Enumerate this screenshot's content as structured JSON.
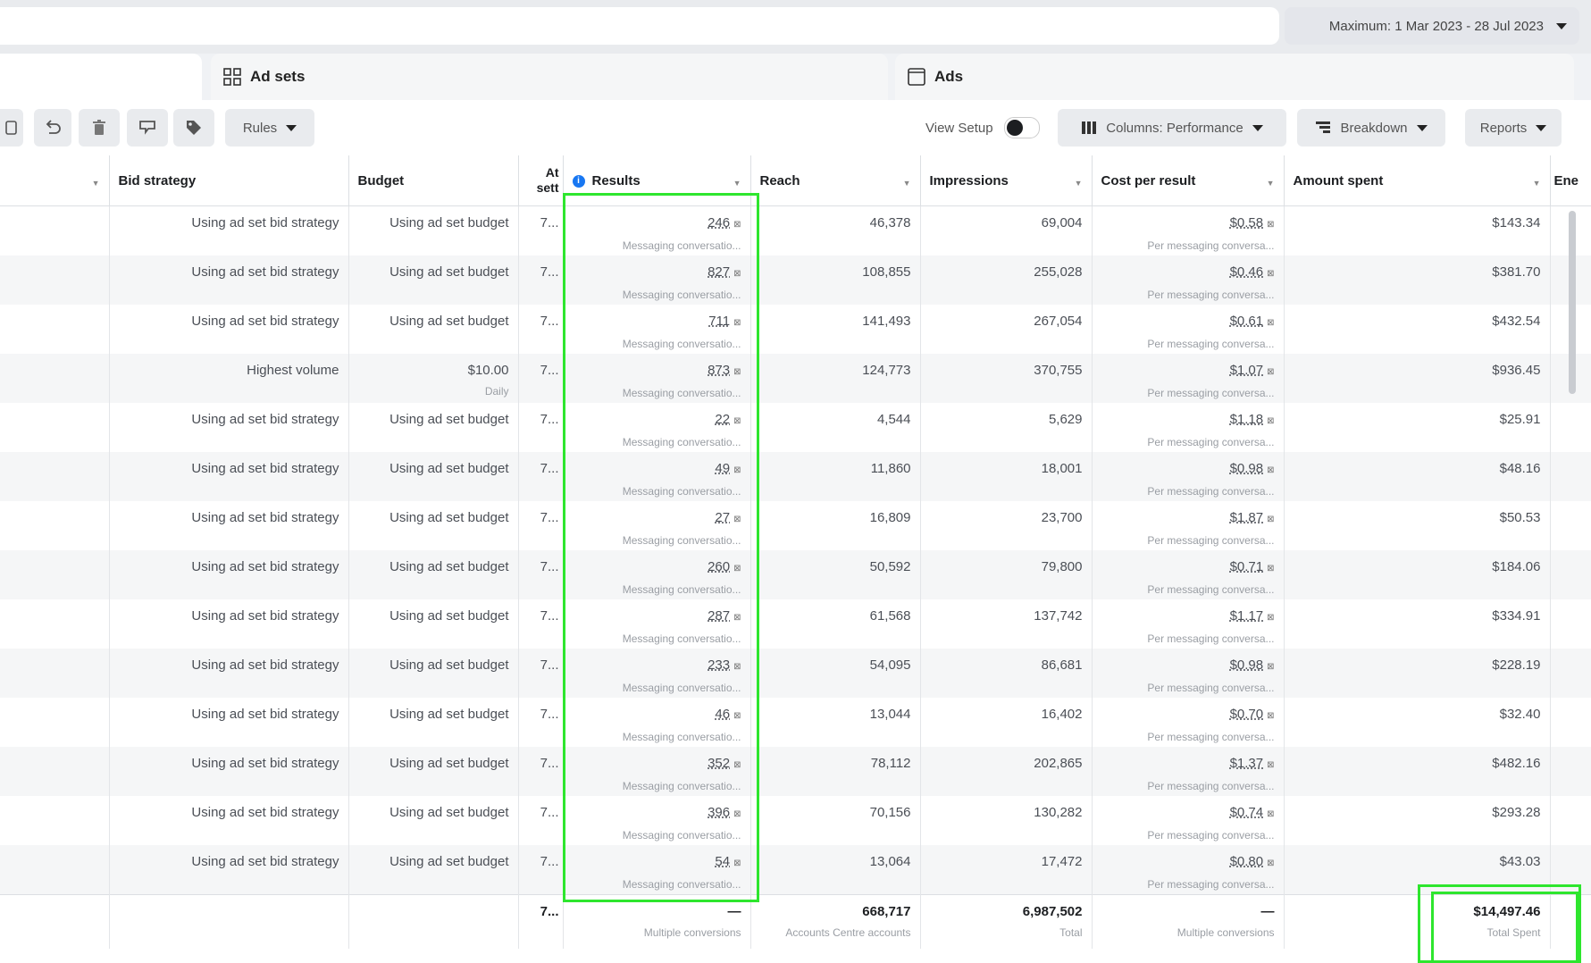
{
  "date_range": "Maximum: 1 Mar 2023 - 28 Jul 2023",
  "tabs": {
    "ad_sets": "Ad sets",
    "ads": "Ads"
  },
  "toolbar": {
    "rules": "Rules",
    "view_setup": "View Setup",
    "columns": "Columns: Performance",
    "breakdown": "Breakdown",
    "reports": "Reports"
  },
  "columns": {
    "bid_strategy": "Bid strategy",
    "budget": "Budget",
    "attribution": "At sett",
    "results": "Results",
    "reach": "Reach",
    "impressions": "Impressions",
    "cost_per_result": "Cost per result",
    "amount_spent": "Amount spent",
    "ends": "Ene"
  },
  "rows": [
    {
      "bid": "Using ad set bid strategy",
      "budget": "Using ad set budget",
      "budget_sub": "",
      "attr": "7...",
      "results": "246",
      "results_sub": "Messaging conversatio...",
      "reach": "46,378",
      "impressions": "69,004",
      "cpr": "$0.58",
      "cpr_sub": "Per messaging conversa...",
      "spent": "$143.34"
    },
    {
      "bid": "Using ad set bid strategy",
      "budget": "Using ad set budget",
      "budget_sub": "",
      "attr": "7...",
      "results": "827",
      "results_sub": "Messaging conversatio...",
      "reach": "108,855",
      "impressions": "255,028",
      "cpr": "$0.46",
      "cpr_sub": "Per messaging conversa...",
      "spent": "$381.70"
    },
    {
      "bid": "Using ad set bid strategy",
      "budget": "Using ad set budget",
      "budget_sub": "",
      "attr": "7...",
      "results": "711",
      "results_sub": "Messaging conversatio...",
      "reach": "141,493",
      "impressions": "267,054",
      "cpr": "$0.61",
      "cpr_sub": "Per messaging conversa...",
      "spent": "$432.54"
    },
    {
      "bid": "Highest volume",
      "budget": "$10.00",
      "budget_sub": "Daily",
      "attr": "7...",
      "results": "873",
      "results_sub": "Messaging conversatio...",
      "reach": "124,773",
      "impressions": "370,755",
      "cpr": "$1.07",
      "cpr_sub": "Per messaging conversa...",
      "spent": "$936.45"
    },
    {
      "bid": "Using ad set bid strategy",
      "budget": "Using ad set budget",
      "budget_sub": "",
      "attr": "7...",
      "results": "22",
      "results_sub": "Messaging conversatio...",
      "reach": "4,544",
      "impressions": "5,629",
      "cpr": "$1.18",
      "cpr_sub": "Per messaging conversa...",
      "spent": "$25.91"
    },
    {
      "bid": "Using ad set bid strategy",
      "budget": "Using ad set budget",
      "budget_sub": "",
      "attr": "7...",
      "results": "49",
      "results_sub": "Messaging conversatio...",
      "reach": "11,860",
      "impressions": "18,001",
      "cpr": "$0.98",
      "cpr_sub": "Per messaging conversa...",
      "spent": "$48.16"
    },
    {
      "bid": "Using ad set bid strategy",
      "budget": "Using ad set budget",
      "budget_sub": "",
      "attr": "7...",
      "results": "27",
      "results_sub": "Messaging conversatio...",
      "reach": "16,809",
      "impressions": "23,700",
      "cpr": "$1.87",
      "cpr_sub": "Per messaging conversa...",
      "spent": "$50.53"
    },
    {
      "bid": "Using ad set bid strategy",
      "budget": "Using ad set budget",
      "budget_sub": "",
      "attr": "7...",
      "results": "260",
      "results_sub": "Messaging conversatio...",
      "reach": "50,592",
      "impressions": "79,800",
      "cpr": "$0.71",
      "cpr_sub": "Per messaging conversa...",
      "spent": "$184.06"
    },
    {
      "bid": "Using ad set bid strategy",
      "budget": "Using ad set budget",
      "budget_sub": "",
      "attr": "7...",
      "results": "287",
      "results_sub": "Messaging conversatio...",
      "reach": "61,568",
      "impressions": "137,742",
      "cpr": "$1.17",
      "cpr_sub": "Per messaging conversa...",
      "spent": "$334.91"
    },
    {
      "bid": "Using ad set bid strategy",
      "budget": "Using ad set budget",
      "budget_sub": "",
      "attr": "7...",
      "results": "233",
      "results_sub": "Messaging conversatio...",
      "reach": "54,095",
      "impressions": "86,681",
      "cpr": "$0.98",
      "cpr_sub": "Per messaging conversa...",
      "spent": "$228.19"
    },
    {
      "bid": "Using ad set bid strategy",
      "budget": "Using ad set budget",
      "budget_sub": "",
      "attr": "7...",
      "results": "46",
      "results_sub": "Messaging conversatio...",
      "reach": "13,044",
      "impressions": "16,402",
      "cpr": "$0.70",
      "cpr_sub": "Per messaging conversa...",
      "spent": "$32.40"
    },
    {
      "bid": "Using ad set bid strategy",
      "budget": "Using ad set budget",
      "budget_sub": "",
      "attr": "7...",
      "results": "352",
      "results_sub": "Messaging conversatio...",
      "reach": "78,112",
      "impressions": "202,865",
      "cpr": "$1.37",
      "cpr_sub": "Per messaging conversa...",
      "spent": "$482.16"
    },
    {
      "bid": "Using ad set bid strategy",
      "budget": "Using ad set budget",
      "budget_sub": "",
      "attr": "7...",
      "results": "396",
      "results_sub": "Messaging conversatio...",
      "reach": "70,156",
      "impressions": "130,282",
      "cpr": "$0.74",
      "cpr_sub": "Per messaging conversa...",
      "spent": "$293.28"
    },
    {
      "bid": "Using ad set bid strategy",
      "budget": "Using ad set budget",
      "budget_sub": "",
      "attr": "7...",
      "results": "54",
      "results_sub": "Messaging conversatio...",
      "reach": "13,064",
      "impressions": "17,472",
      "cpr": "$0.80",
      "cpr_sub": "Per messaging conversa...",
      "spent": "$43.03"
    }
  ],
  "totals": {
    "attr": "7...",
    "results": "—",
    "results_sub": "Multiple conversions",
    "reach": "668,717",
    "reach_sub": "Accounts Centre accounts",
    "impressions": "6,987,502",
    "impressions_sub": "Total",
    "cpr": "—",
    "cpr_sub": "Multiple conversions",
    "spent": "$14,497.46",
    "spent_sub": "Total Spent"
  },
  "colors": {
    "highlight": "#2ee62e",
    "info": "#1877f2"
  }
}
